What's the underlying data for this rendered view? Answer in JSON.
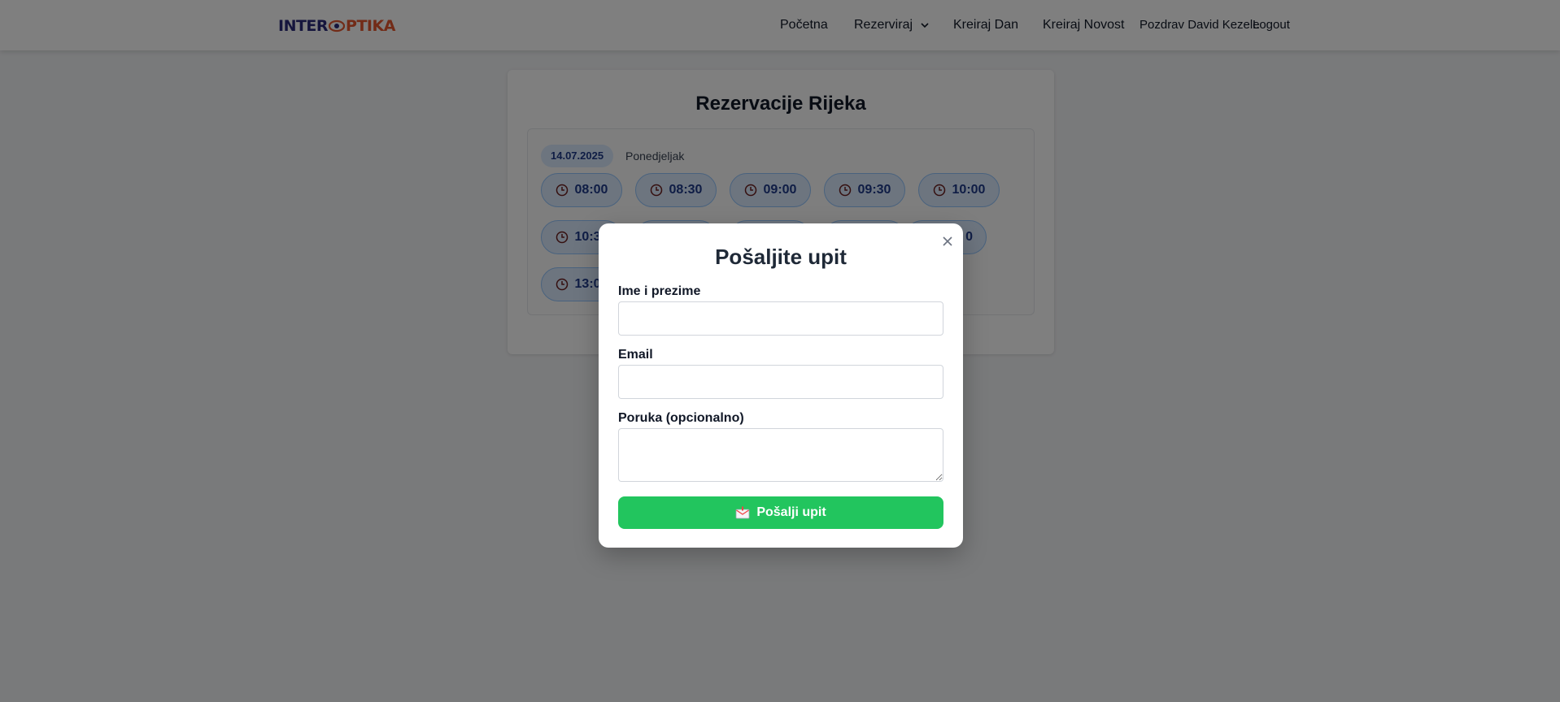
{
  "header": {
    "logo": {
      "part1": "INTER",
      "part2": "PTIKA"
    },
    "nav": [
      {
        "label": "Početna"
      },
      {
        "label": "Rezerviraj"
      },
      {
        "label": "Kreiraj Dan"
      },
      {
        "label": "Kreiraj Novost"
      }
    ],
    "greeting": "Pozdrav David Kezele",
    "logout": "Logout"
  },
  "card": {
    "title": "Rezervacije Rijeka",
    "date": "14.07.2025",
    "weekday": "Ponedjeljak",
    "slots": [
      "08:00",
      "08:30",
      "09:00",
      "09:30",
      "10:00",
      "10:30",
      "0",
      "13:00"
    ]
  },
  "modal": {
    "title": "Pošaljite upit",
    "name_label": "Ime i prezime",
    "name_value": "",
    "email_label": "Email",
    "email_value": "",
    "message_label": "Poruka (opcionalno)",
    "message_value": "",
    "submit_label": "Pošalji upit"
  },
  "colors": {
    "brand_dark": "#2b2a7a",
    "brand_orange": "#e4572e",
    "slot_bg": "#dbeafe",
    "slot_text": "#1e3a8a",
    "submit": "#22c55e"
  },
  "icons": [
    "eye-icon",
    "chevron-down-icon",
    "clock-icon",
    "close-icon",
    "mail-icon"
  ]
}
